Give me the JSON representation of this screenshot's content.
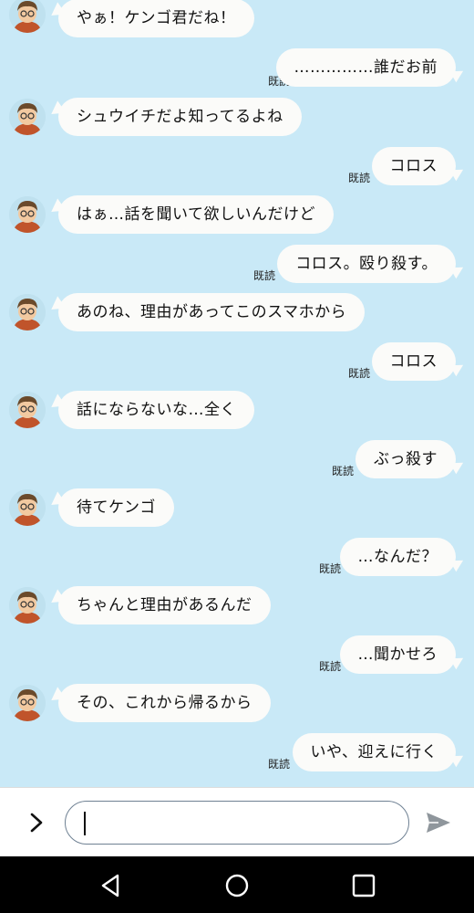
{
  "read_label": "既読",
  "messages": [
    {
      "side": "in",
      "text": "やぁ！ケンゴ君だね！"
    },
    {
      "side": "out",
      "text": "……………誰だお前"
    },
    {
      "side": "in",
      "text": "シュウイチだよ知ってるよね"
    },
    {
      "side": "out",
      "text": "コロス"
    },
    {
      "side": "in",
      "text": "はぁ…話を聞いて欲しいんだけど"
    },
    {
      "side": "out",
      "text": "コロス。殴り殺す。"
    },
    {
      "side": "in",
      "text": "あのね、理由があってこのスマホから"
    },
    {
      "side": "out",
      "text": "コロス"
    },
    {
      "side": "in",
      "text": "話にならないな…全く"
    },
    {
      "side": "out",
      "text": "ぶっ殺す"
    },
    {
      "side": "in",
      "text": "待てケンゴ"
    },
    {
      "side": "out",
      "text": "…なんだ？"
    },
    {
      "side": "in",
      "text": "ちゃんと理由があるんだ"
    },
    {
      "side": "out",
      "text": "…聞かせろ"
    },
    {
      "side": "in",
      "text": "その、これから帰るから"
    },
    {
      "side": "out",
      "text": "いや、迎えに行く"
    }
  ],
  "composer": {
    "value": ""
  },
  "icons": {
    "expand": "chevron-right-icon",
    "send": "send-icon",
    "back": "back-triangle-icon",
    "home": "home-circle-icon",
    "recents": "recents-square-icon"
  },
  "colors": {
    "background": "#c9e9f7",
    "bubble": "#fbfbf9",
    "navbar": "#000000"
  }
}
